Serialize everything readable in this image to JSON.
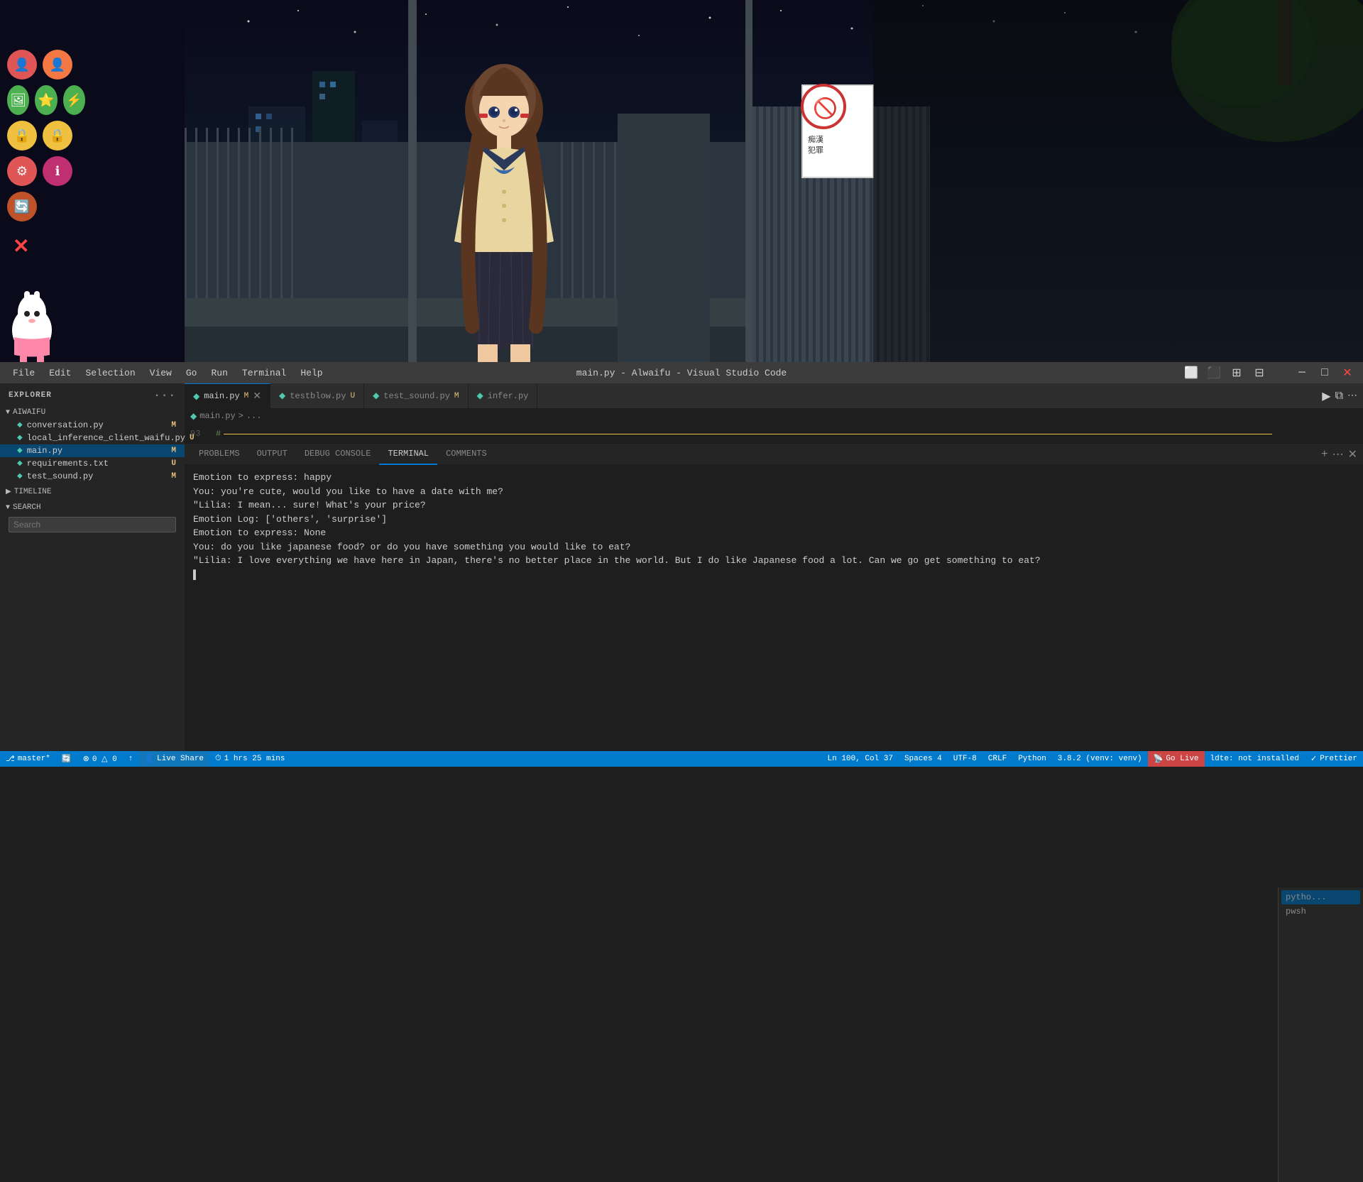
{
  "window": {
    "title": "main.py - Alwaifu - Visual Studio Code"
  },
  "anime": {
    "scene_bg": "night city background with fence"
  },
  "icons": [
    {
      "row": 0,
      "items": [
        {
          "color": "#e05555",
          "symbol": "👤",
          "name": "user-red-icon"
        },
        {
          "color": "#f47843",
          "symbol": "🔴",
          "name": "user-orange-icon"
        }
      ]
    },
    {
      "row": 1,
      "items": [
        {
          "color": "#4caf50",
          "symbol": "🖼",
          "name": "image-green-icon"
        },
        {
          "color": "#4caf50",
          "symbol": "⭐",
          "name": "star-green-icon"
        },
        {
          "color": "#4caf50",
          "symbol": "⚡",
          "name": "bolt-green-icon"
        }
      ]
    },
    {
      "row": 2,
      "items": [
        {
          "color": "#f0c040",
          "symbol": "🔒",
          "name": "lock-yellow-icon"
        },
        {
          "color": "#f0c040",
          "symbol": "🔒",
          "name": "lock-yellow2-icon"
        }
      ]
    },
    {
      "row": 3,
      "items": [
        {
          "color": "#e05555",
          "symbol": "⚙",
          "name": "gear-red-icon"
        },
        {
          "color": "#e05588",
          "symbol": "ℹ",
          "name": "info-pink-icon"
        }
      ]
    },
    {
      "row": 4,
      "items": [
        {
          "color": "#c0522a",
          "symbol": "🔄",
          "name": "refresh-brown-icon"
        }
      ]
    }
  ],
  "menubar": {
    "items": [
      "File",
      "Edit",
      "Selection",
      "View",
      "Go",
      "Run",
      "Terminal",
      "Help"
    ],
    "title": "main.py - Alwaifu - Visual Studio Code"
  },
  "sidebar": {
    "header": "EXPLORER",
    "dots_label": "···",
    "sections": [
      {
        "name": "AIWAIFU",
        "files": [
          {
            "name": "conversation.py",
            "badge": "M",
            "dot_color": "#4ec9b0"
          },
          {
            "name": "local_inference_client_waifu.py",
            "badge": "U",
            "dot_color": "#4ec9b0"
          },
          {
            "name": "main.py",
            "badge": "M",
            "dot_color": "#4ec9b0",
            "active": true
          },
          {
            "name": "requirements.txt",
            "badge": "U",
            "dot_color": "#4ec9b0"
          },
          {
            "name": "test_sound.py",
            "badge": "M",
            "dot_color": "#4ec9b0"
          }
        ]
      },
      {
        "name": "TIMELINE",
        "files": []
      },
      {
        "name": "SEARCH",
        "files": [],
        "has_input": true,
        "placeholder": "Search"
      }
    ]
  },
  "tabs": [
    {
      "name": "main.py",
      "badge": "M",
      "active": true,
      "closable": true,
      "icon_color": "#4ec9b0"
    },
    {
      "name": "testblow.py",
      "badge": "U",
      "active": false,
      "closable": false,
      "icon_color": "#4ec9b0"
    },
    {
      "name": "test_sound.py",
      "badge": "M",
      "active": false,
      "closable": false,
      "icon_color": "#4ec9b0"
    },
    {
      "name": "infer.py",
      "badge": "",
      "active": false,
      "closable": false,
      "icon_color": "#4ec9b0"
    }
  ],
  "breadcrumb": {
    "parts": [
      "main.py",
      ">",
      "..."
    ]
  },
  "code_line": {
    "line_number": "93",
    "content": "#"
  },
  "terminal": {
    "tabs": [
      "PROBLEMS",
      "OUTPUT",
      "DEBUG CONSOLE",
      "TERMINAL",
      "COMMENTS"
    ],
    "active_tab": "TERMINAL",
    "lines": [
      "Emotion to express: happy",
      "You: you're cute, would you like to have a date with me?",
      "\"Lilia: I mean... sure! What's your price?",
      "Emotion Log: ['others', 'surprise']",
      "Emotion to express: None",
      "You: do you like japanese food? or do you have something you would like to eat?",
      "\"Lilia: I love everything we have here in Japan, there's no better place in the world. But I do like Japanese food a lot. Can we go get something to eat?",
      "▌"
    ],
    "right_panel": [
      {
        "label": "pytho...",
        "active": true
      },
      {
        "label": "pwsh",
        "active": false
      }
    ]
  },
  "statusbar": {
    "left": [
      {
        "icon": "⎇",
        "text": "master*",
        "name": "git-branch"
      },
      {
        "icon": "🔄",
        "text": "",
        "name": "sync"
      },
      {
        "icon": "⊘",
        "text": "0 △ 0",
        "name": "errors"
      },
      {
        "icon": "↑",
        "text": "",
        "name": "push"
      },
      {
        "icon": "👤",
        "text": "Live Share",
        "name": "live-share"
      },
      {
        "icon": "⏱",
        "text": "1 hrs 25 mins",
        "name": "timer"
      }
    ],
    "right": [
      {
        "text": "Ln 100, Col 37",
        "name": "cursor-position"
      },
      {
        "text": "Spaces 4",
        "name": "indentation"
      },
      {
        "text": "UTF-8",
        "name": "encoding"
      },
      {
        "text": "CRLF",
        "name": "line-ending"
      },
      {
        "text": "Python",
        "name": "language"
      },
      {
        "text": "3.8.2 (venv: venv)",
        "name": "python-version"
      },
      {
        "text": "Go Live",
        "name": "go-live"
      },
      {
        "text": "ldte: not installed",
        "name": "ldte"
      },
      {
        "text": "Prettier",
        "name": "prettier"
      }
    ]
  }
}
